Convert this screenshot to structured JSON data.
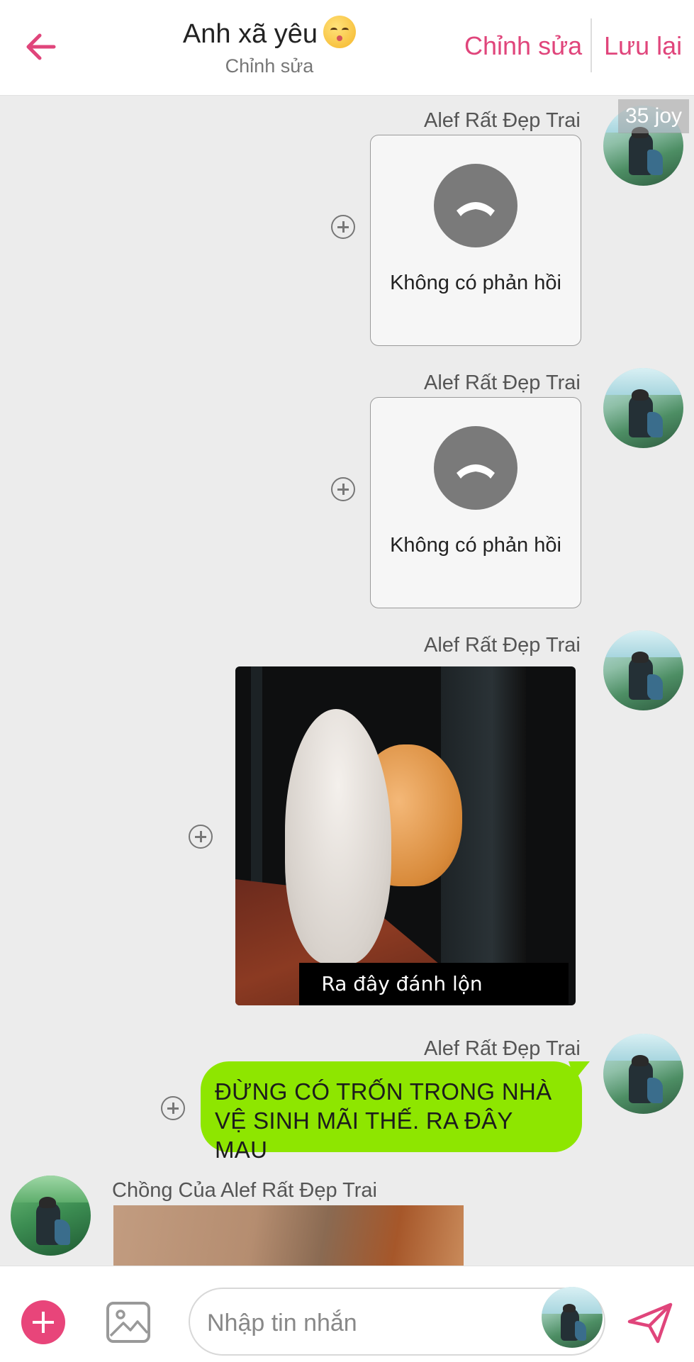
{
  "header": {
    "title": "Anh xã yêu",
    "title_emoji": "kissing-face-emoji",
    "subtitle": "Chỉnh sửa",
    "edit_label": "Chỉnh sửa",
    "save_label": "Lưu lại"
  },
  "badge": "35 joy",
  "messages": [
    {
      "sender": "Alef Rất Đẹp Trai",
      "type": "call",
      "call_status": "Không có phản hồi"
    },
    {
      "sender": "Alef Rất Đẹp Trai",
      "type": "call",
      "call_status": "Không có phản hồi"
    },
    {
      "sender": "Alef Rất Đẹp Trai",
      "type": "gif",
      "gif_caption": "Ra đây đánh lộn"
    },
    {
      "sender": "Alef Rất Đẹp Trai",
      "type": "text",
      "text": "ĐỪNG CÓ TRỐN TRONG NHÀ VỆ SINH MÃI THẾ. RA ĐÂY MAU"
    },
    {
      "sender": "Chồng Của Alef Rất Đẹp Trai",
      "type": "image"
    }
  ],
  "composer": {
    "placeholder": "Nhập tin nhắn",
    "value": ""
  },
  "colors": {
    "accent": "#e0457b",
    "bubble": "#8ee600",
    "background": "#ececec"
  }
}
